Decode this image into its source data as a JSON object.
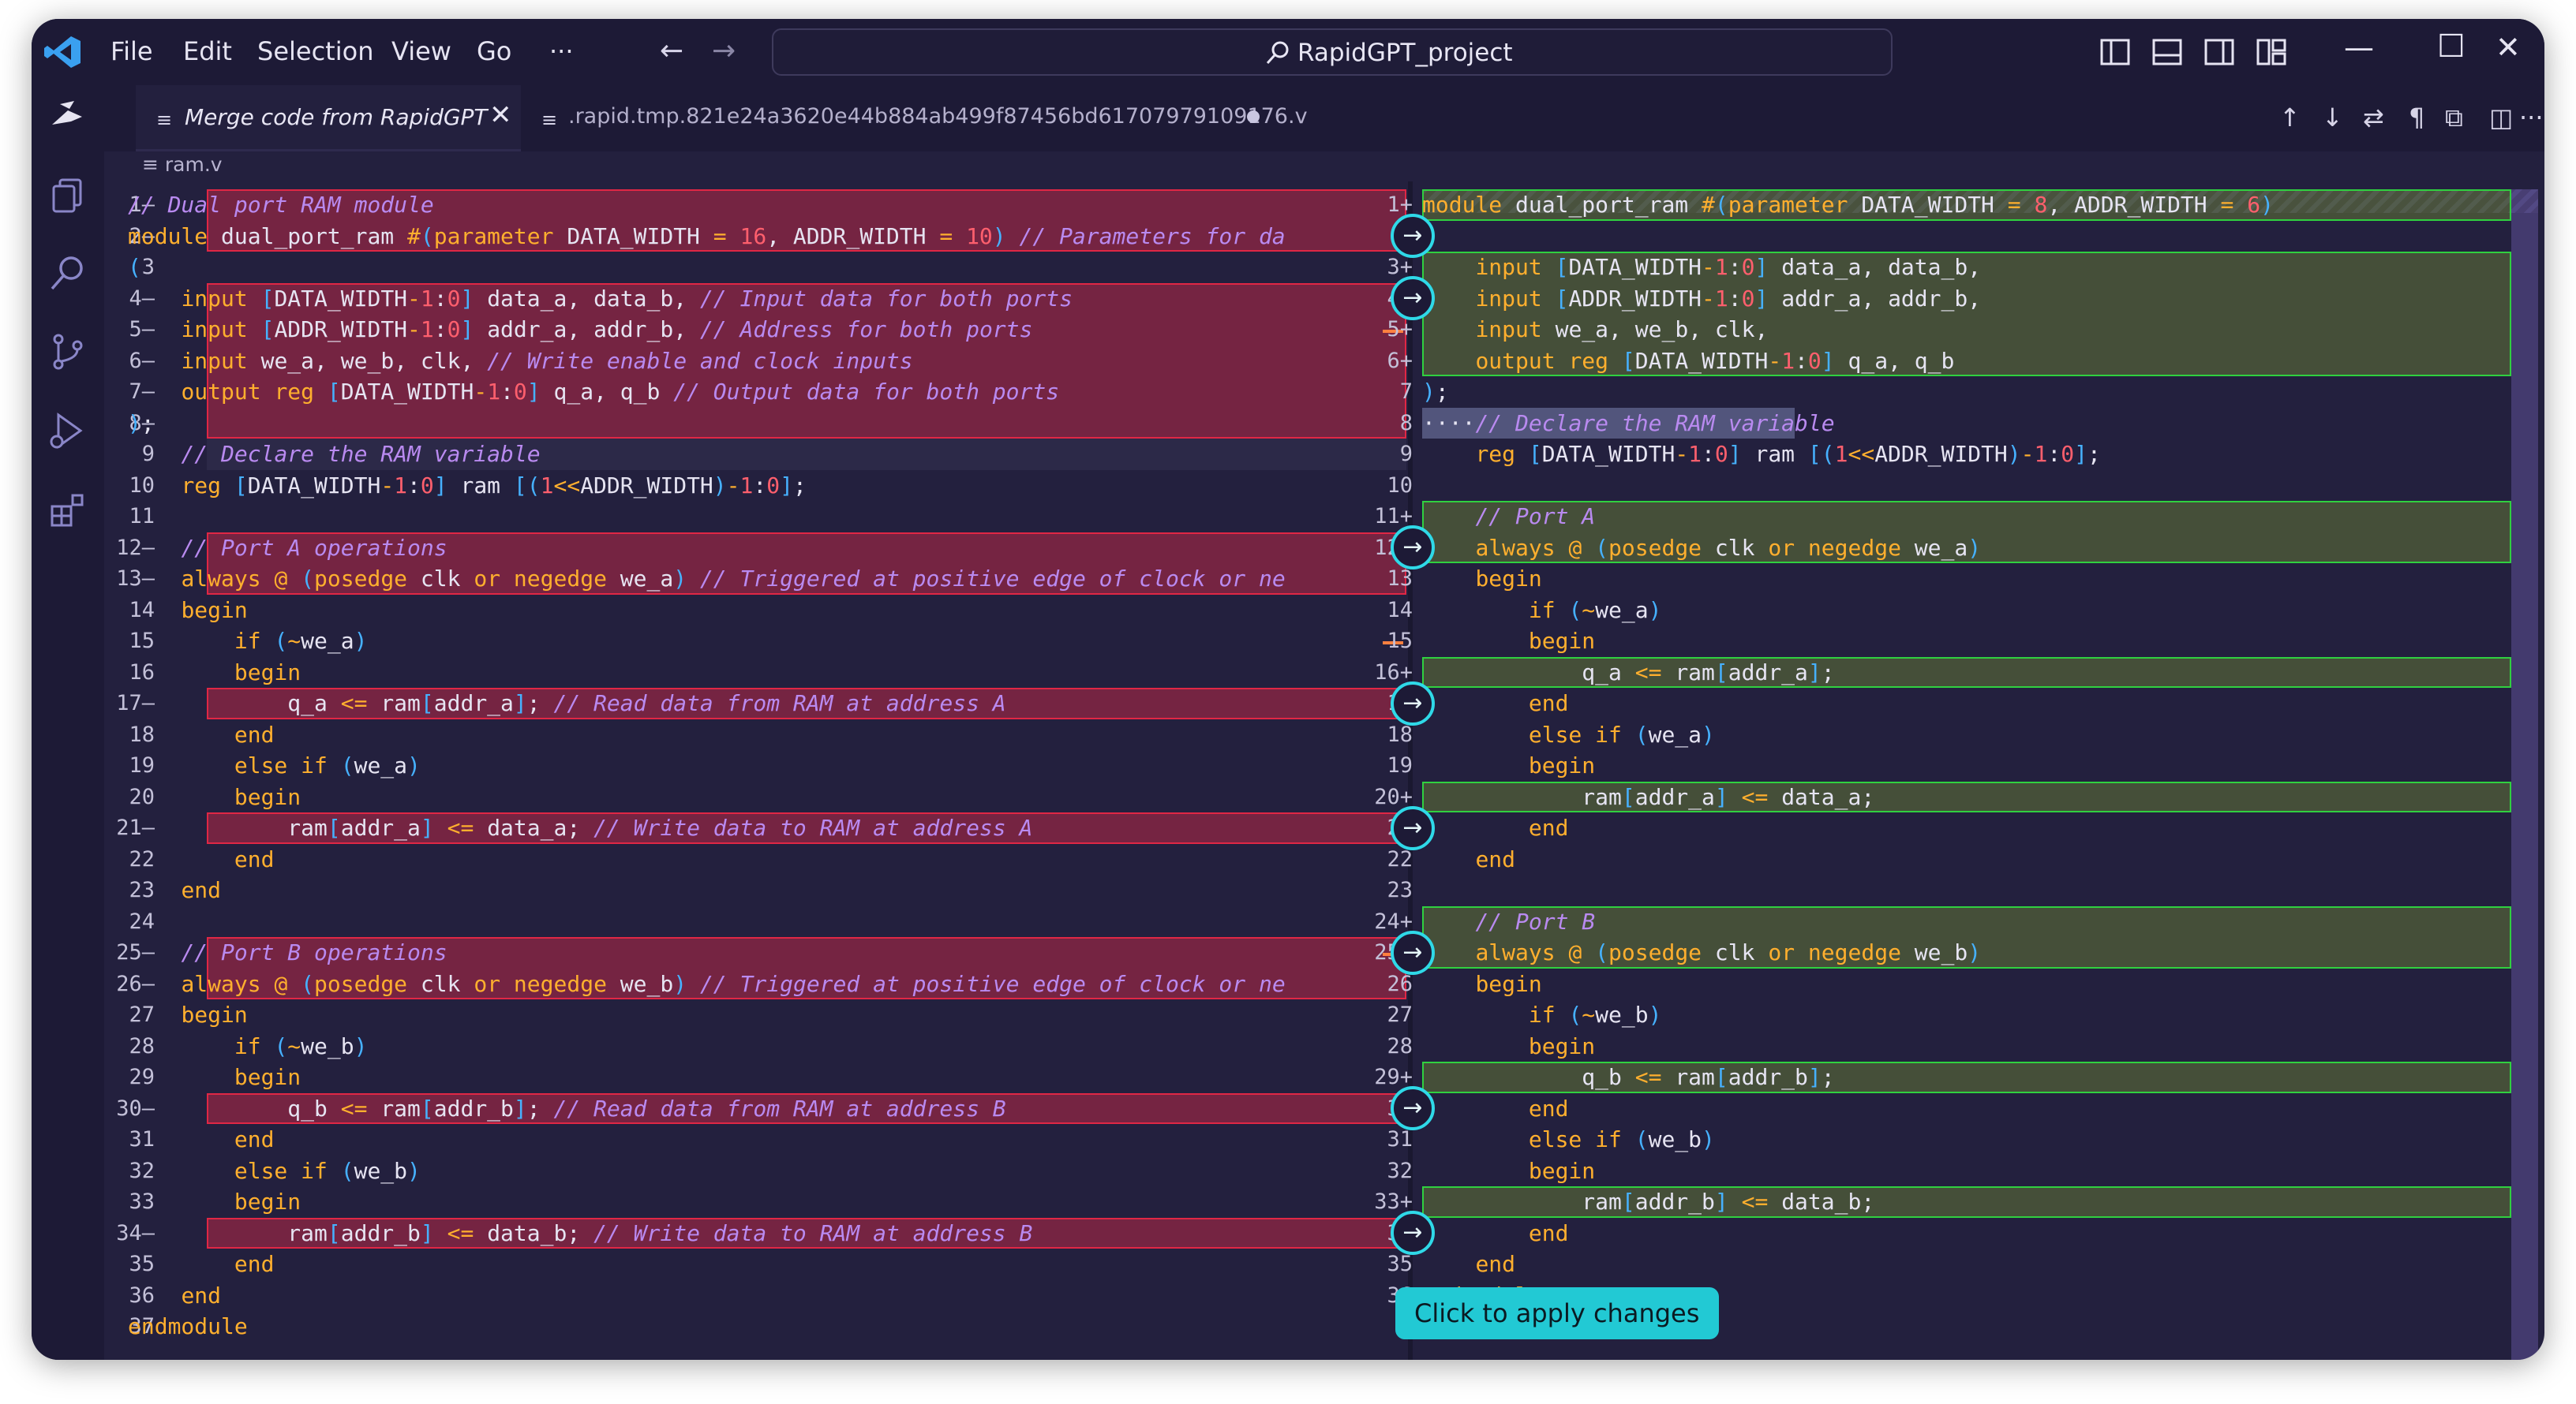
{
  "window": {
    "search_text": "RapidGPT_project"
  },
  "menu": [
    {
      "label": "File"
    },
    {
      "label": "Edit"
    },
    {
      "label": "Selection"
    },
    {
      "label": "View"
    },
    {
      "label": "Go"
    },
    {
      "label": "···"
    }
  ],
  "tabs": [
    {
      "label": "Merge code from RapidGPT",
      "active": true
    },
    {
      "label": ".rapid.tmp.821e24a3620e44b884ab499f87456bd61707979109176.v",
      "active": false
    }
  ],
  "breadcrumb": "ram.v",
  "callout": "Click to apply changes",
  "colors": {
    "accent": "#2fd9e8",
    "removed": "#c82846",
    "added": "#30d040",
    "keyword": "#ffaf2e",
    "comment": "#b98af0",
    "number": "#ff5f6d",
    "bracket": "#46b1ff"
  },
  "left_numbers": [
    "1—",
    "2—",
    "3",
    "4—",
    "5—",
    "6—",
    "7—",
    "8—",
    "9",
    "10",
    "11",
    "12—",
    "13—",
    "14",
    "15",
    "16",
    "17—",
    "18",
    "19",
    "20",
    "21—",
    "22",
    "23",
    "24",
    "25—",
    "26—",
    "27",
    "28",
    "29",
    "30—",
    "31",
    "32",
    "33",
    "34—",
    "35",
    "36",
    "37"
  ],
  "right_numbers": [
    "1+",
    "2",
    "3+",
    "4+",
    "5+",
    "6+",
    "7",
    "8",
    "9",
    "10",
    "11+",
    "12+",
    "13",
    "14",
    "15",
    "16+",
    "17",
    "18",
    "19",
    "20+",
    "21",
    "22",
    "23",
    "24+",
    "25+",
    "26",
    "27",
    "28",
    "29+",
    "30",
    "31",
    "32",
    "33+",
    "34",
    "35",
    "36"
  ],
  "left_code": [
    "// Dual port RAM module",
    "module dual_port_ram #(parameter DATA_WIDTH = 16, ADDR_WIDTH = 10) // Parameters for da",
    "(",
    "    input [DATA_WIDTH-1:0] data_a, data_b, // Input data for both ports",
    "    input [ADDR_WIDTH-1:0] addr_a, addr_b, // Address for both ports",
    "    input we_a, we_b, clk, // Write enable and clock inputs",
    "    output reg [DATA_WIDTH-1:0] q_a, q_b // Output data for both ports",
    ");",
    "    // Declare the RAM variable",
    "    reg [DATA_WIDTH-1:0] ram [(1<<ADDR_WIDTH)-1:0];",
    "",
    "    // Port A operations",
    "    always @ (posedge clk or negedge we_a) // Triggered at positive edge of clock or ne",
    "    begin",
    "        if (~we_a)",
    "        begin",
    "            q_a <= ram[addr_a]; // Read data from RAM at address A",
    "        end",
    "        else if (we_a)",
    "        begin",
    "            ram[addr_a] <= data_a; // Write data to RAM at address A",
    "        end",
    "    end",
    "",
    "    // Port B operations",
    "    always @ (posedge clk or negedge we_b) // Triggered at positive edge of clock or ne",
    "    begin",
    "        if (~we_b)",
    "        begin",
    "            q_b <= ram[addr_b]; // Read data from RAM at address B",
    "        end",
    "        else if (we_b)",
    "        begin",
    "            ram[addr_b] <= data_b; // Write data to RAM at address B",
    "        end",
    "    end",
    "endmodule"
  ],
  "right_code": [
    "module dual_port_ram #(parameter DATA_WIDTH = 8, ADDR_WIDTH = 6)",
    "(",
    "    input [DATA_WIDTH-1:0] data_a, data_b,",
    "    input [ADDR_WIDTH-1:0] addr_a, addr_b,",
    "    input we_a, we_b, clk,",
    "    output reg [DATA_WIDTH-1:0] q_a, q_b",
    ");",
    "····// Declare the RAM variable",
    "    reg [DATA_WIDTH-1:0] ram [(1<<ADDR_WIDTH)-1:0];",
    "",
    "    // Port A",
    "    always @ (posedge clk or negedge we_a)",
    "    begin",
    "        if (~we_a)",
    "        begin",
    "            q_a <= ram[addr_a];",
    "        end",
    "        else if (we_a)",
    "        begin",
    "            ram[addr_a] <= data_a;",
    "        end",
    "    end",
    "",
    "    // Port B",
    "    always @ (posedge clk or negedge we_b)",
    "    begin",
    "        if (~we_b)",
    "        begin",
    "            q_b <= ram[addr_b];",
    "        end",
    "        else if (we_b)",
    "        begin",
    "            ram[addr_b] <= data_b;",
    "        end",
    "    end",
    "endmodule"
  ]
}
